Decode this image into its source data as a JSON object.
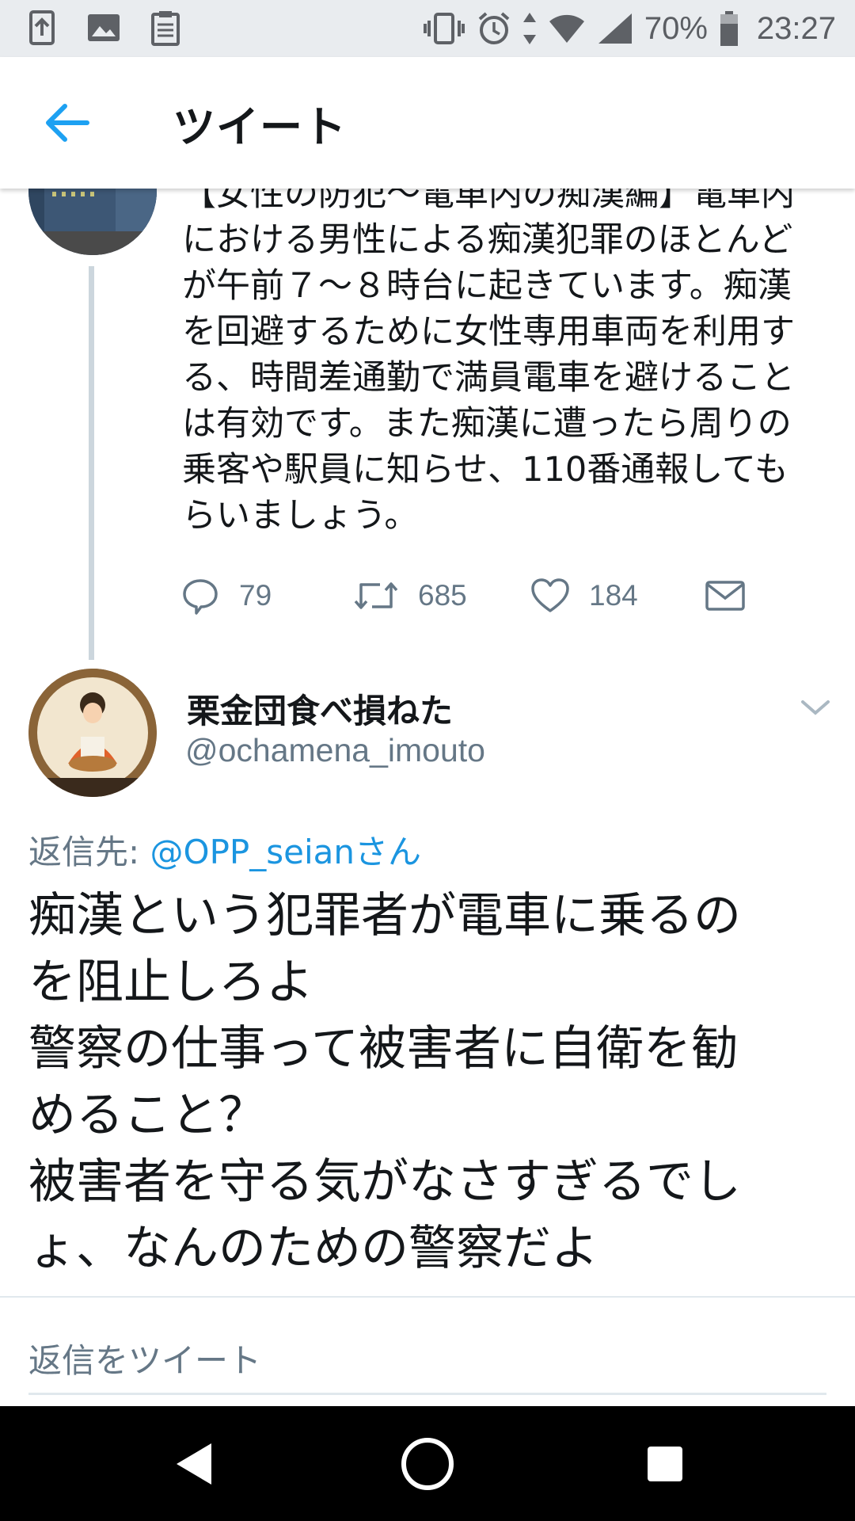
{
  "status_bar": {
    "left_icons": [
      "upload-icon",
      "image-icon",
      "clipboard-icon"
    ],
    "right_icons": [
      "vibrate-icon",
      "alarm-icon",
      "data-arrows-icon",
      "wifi-icon",
      "signal-icon"
    ],
    "battery_percent": "70%",
    "battery_level": 0.7,
    "time": "23:27"
  },
  "app_bar": {
    "back_icon": "back-arrow-icon",
    "title": "ツイート"
  },
  "parent_tweet": {
    "text": "【女性の防犯〜電車内の痴漢編】電車内\nにおける男性による痴漢犯罪のほとんど\nが午前７〜８時台に起きています。痴漢\nを回避するために女性専用車両を利用す\nる、時間差通勤で満員電車を避けること\nは有効です。また痴漢に遭ったら周りの\n乗客や駅員に知らせ、110番通報しても\nらいましょう。",
    "actions": {
      "replies": "79",
      "retweets": "685",
      "likes": "184"
    }
  },
  "main_tweet": {
    "author_name": "栗金団食べ損ねた",
    "author_handle": "@ochamena_imouto",
    "reply_label": "返信先: ",
    "reply_handle": "@OPP_seianさん",
    "text": "痴漢という犯罪者が電車に乗るの\nを阻止しろよ\n警察の仕事って被害者に自衛を勧\nめること？\n被害者を守る気がなさすぎるでし\nょ、なんのための警察だよ"
  },
  "reply_box": {
    "placeholder": "返信をツイート"
  },
  "colors": {
    "accent": "#1da1f2",
    "secondary_text": "#657786",
    "primary_text": "#14171a",
    "divider": "#e1e8ed",
    "thread_line": "#ccd6dd"
  }
}
